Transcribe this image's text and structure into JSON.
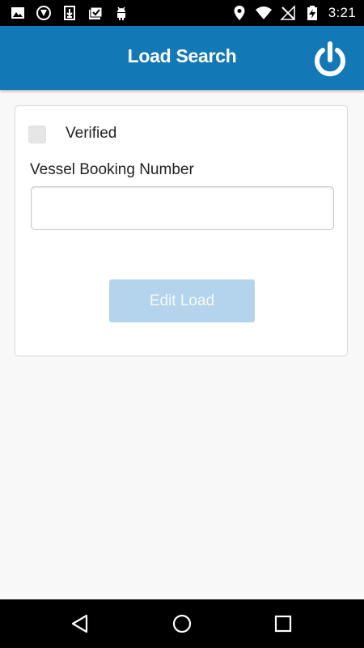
{
  "status_bar": {
    "time": "3:21",
    "left_icons": [
      "image-icon",
      "vpn-shield-icon",
      "download-icon",
      "clipboard-check-icon",
      "android-debug-icon"
    ],
    "right_icons": [
      "location-pin-icon",
      "wifi-icon",
      "no-signal-icon",
      "battery-charging-icon"
    ]
  },
  "app_bar": {
    "title": "Load Search",
    "power_icon": "power-icon",
    "color": "#1279b6"
  },
  "form": {
    "verified_label": "Verified",
    "verified_checked": false,
    "vessel_label": "Vessel Booking Number",
    "vessel_value": "",
    "vessel_placeholder": "",
    "edit_button_label": "Edit Load",
    "edit_button_color": "#b3d4ec"
  },
  "nav_bar": {
    "buttons": [
      "back-icon",
      "home-icon",
      "recents-icon"
    ]
  }
}
